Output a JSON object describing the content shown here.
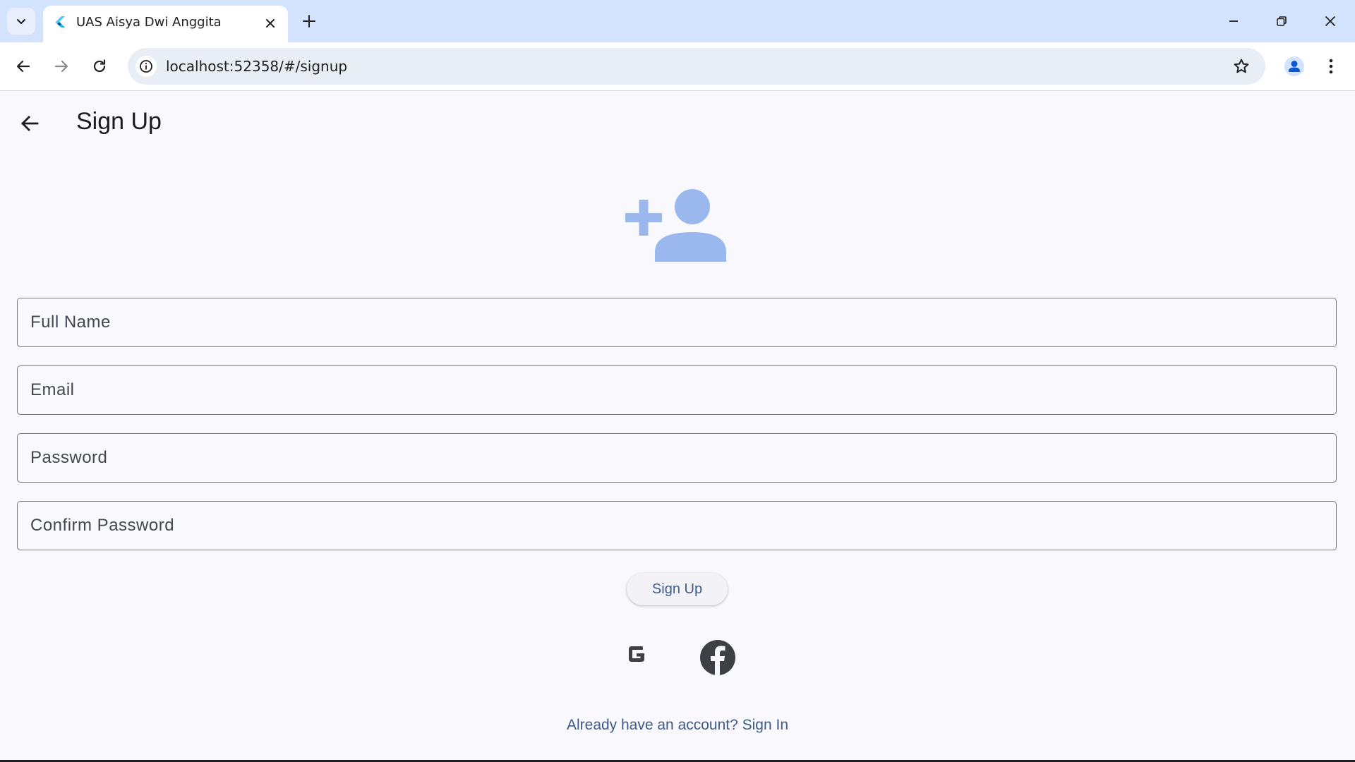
{
  "browser": {
    "tab_title": "UAS Aisya Dwi Anggita",
    "url": "localhost:52358/#/signup"
  },
  "app": {
    "page_title": "Sign Up",
    "fields": {
      "full_name_placeholder": "Full Name",
      "email_placeholder": "Email",
      "password_placeholder": "Password",
      "confirm_password_placeholder": "Confirm Password"
    },
    "signup_button_label": "Sign Up",
    "signin_link_text": "Already have an account? Sign In"
  },
  "colors": {
    "tabstrip_bg": "#d3e3fd",
    "page_bg": "#f9f9fd",
    "accent_text": "#3d5a8a",
    "hero_icon": "#9bb8ee",
    "social_icon": "#3f4046"
  },
  "icons": [
    "tab-search-icon",
    "flutter-icon",
    "close-icon",
    "plus-icon",
    "minimize-icon",
    "restore-icon",
    "back-icon",
    "forward-icon",
    "reload-icon",
    "info-icon",
    "star-icon",
    "profile-icon",
    "kebab-menu-icon",
    "arrow-back-icon",
    "person-add-icon",
    "google-icon",
    "facebook-icon"
  ]
}
